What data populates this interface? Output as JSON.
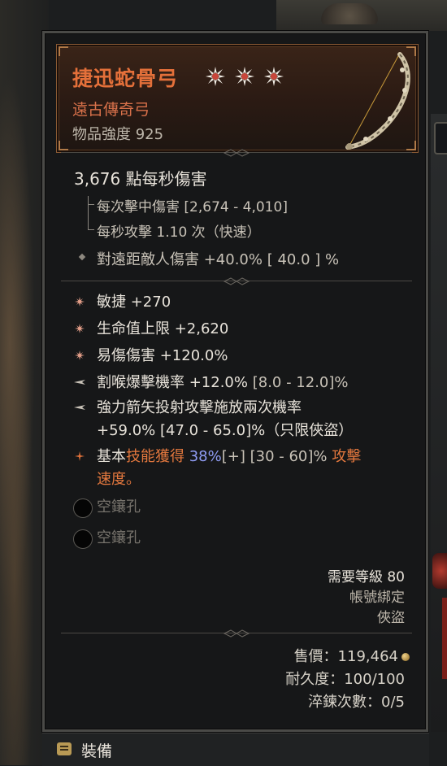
{
  "item": {
    "name": "捷迅蛇骨弓",
    "rarity": "遠古傳奇弓",
    "power": "物品強度 925"
  },
  "weapon": {
    "dps": "3,676 點每秒傷害",
    "damage_per_hit": "每次擊中傷害 [2,674 - 4,010]",
    "attack_speed": "每秒攻擊 1.10 次（快速）",
    "implicit": "對遠距敵人傷害 +40.0%  [ 40.0 ] %"
  },
  "affixes": [
    {
      "text": "敏捷 +270"
    },
    {
      "text": "生命值上限 +2,620"
    },
    {
      "text": "易傷傷害 +120.0%"
    },
    {
      "stat": "割喉爆擊機率 +12.0%",
      "range": " [8.0 - 12.0]%"
    },
    {
      "line1": "強力箭矢投射攻擊施放兩次機率",
      "line2": "+59.0% [47.0 - 65.0]%（只限俠盜）"
    }
  ],
  "aspect": {
    "part1": "基本",
    "part2": "技能獲得",
    "value": "38%",
    "bracket": "[+]",
    "range": " [30 - 60]%",
    "part3": "攻擊",
    "part4": "速度。"
  },
  "sockets": [
    {
      "label": "空鑲孔"
    },
    {
      "label": "空鑲孔"
    }
  ],
  "requirements": {
    "level": "需要等級 80",
    "bound": "帳號綁定",
    "class": "俠盜"
  },
  "footer_stats": {
    "sell_price": "售價：119,464",
    "durability": "耐久度：100/100",
    "temper": "淬鍊次數：0/5"
  },
  "bottom_bar": {
    "label": "裝備"
  },
  "colors": {
    "legendary_orange": "#e4703a",
    "skill_blue": "#8e9bf2"
  }
}
